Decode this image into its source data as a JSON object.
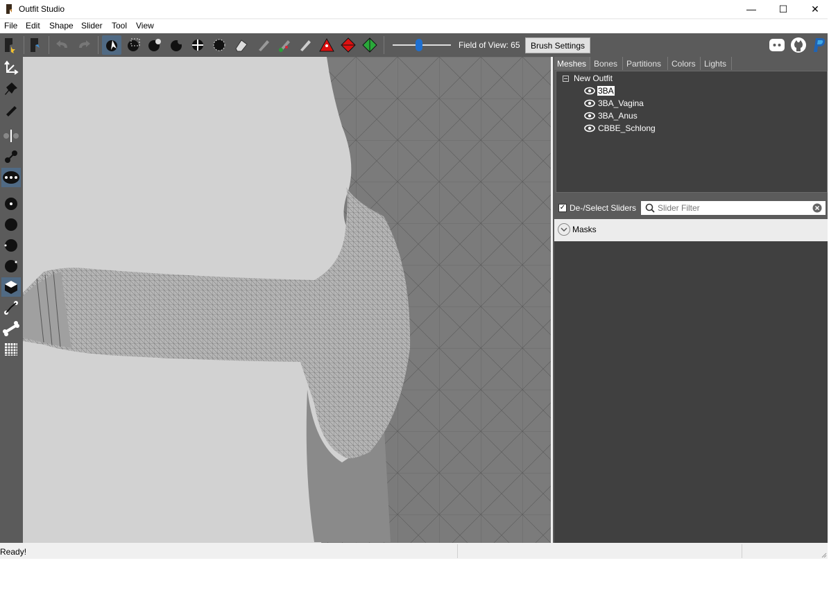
{
  "window": {
    "title": "Outfit Studio",
    "controls": {
      "minimize": "—",
      "maximize": "☐",
      "close": "✕"
    }
  },
  "menu": [
    "File",
    "Edit",
    "Shape",
    "Slider",
    "Tool",
    "View"
  ],
  "toolbar": {
    "field_of_view_label": "Field of View: 65",
    "field_of_view_level": 0.45,
    "brush_settings_label": "Brush Settings",
    "accent_color": "#1e6fd0"
  },
  "right_panel": {
    "tabs": [
      "Meshes",
      "Bones",
      "Partitions",
      "Colors",
      "Lights"
    ],
    "active_tab": "Meshes",
    "tree": {
      "root": "New Outfit",
      "items": [
        "3BA",
        "3BA_Vagina",
        "3BA_Anus",
        "CBBE_Schlong"
      ],
      "selected": "3BA"
    },
    "deselect_sliders_label": "De-/Select Sliders",
    "deselect_checked": true,
    "slider_filter_placeholder": "Slider Filter",
    "masks_label": "Masks"
  },
  "status": {
    "text": "Ready!"
  },
  "colors": {
    "toolbar_bg": "#5b5b5b",
    "viewport_bg": "#d2d2d2",
    "panel_dark": "#404040",
    "active_tool": "#506a84"
  }
}
